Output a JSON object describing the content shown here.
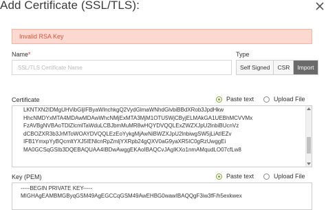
{
  "dialog": {
    "title": "Add Certificate (SSL/TLS):"
  },
  "alert": {
    "message": "Invalid RSA Key"
  },
  "name_field": {
    "label": "Name",
    "required_marker": "*",
    "placeholder": "SSL/TLS Certificate Name",
    "value": ""
  },
  "type_field": {
    "label": "Type",
    "options": [
      "Self Signed",
      "CSR",
      "Import"
    ],
    "selected": "Import"
  },
  "certificate": {
    "label": "Certificate",
    "radio_paste": "Paste text",
    "radio_upload": "Upload File",
    "selected": "Paste text",
    "lines": [
      "LKNTXN2IDMgUHVibGljIFByaWlnchkgQ2VydGlmaWNhdGlvbiBBdXRob3JpdHkw",
      "HhcNMDYxMTA4MDAwMDAwWhcNMjExMTA3MjM1OTU5WjCByjELMAkGA1UEBhMCVVMx",
      "FzAVBgNVBAoTDlZlcmlTaWduLCBJbmMuMR8wHQYDVQQLExZWZXJpU2lnbiBUcnVz",
      "dCBOZXR3b3JrMToWOAYDVQQLEzEoYykgMjAwNiBWZXJpU2lnbiwgSW5jLiAtIEZv",
      "IFB1YmxpYyBQcmltYXJ5IENlcnRpZmljYXRpb24gQXV0aG9yaXR5IC0gRzUwggEi",
      "MA0GCSqGSIb3DQEBAQUAA4IBDwAwggEKAoIBAQCvJAgIKXo1nmAMqudLO07cfLw8"
    ]
  },
  "key": {
    "label": "Key (PEM)",
    "radio_paste": "Paste text",
    "radio_upload": "Upload File",
    "selected": "Paste text",
    "lines": [
      "-----BEGIN PRIVATE KEY-----",
      "MIGHAgEAMBMGByqGSM49AgEGCCqGSM49AwEHBG0wawIBAQQgF3iw3fF/h5exkwex"
    ]
  }
}
